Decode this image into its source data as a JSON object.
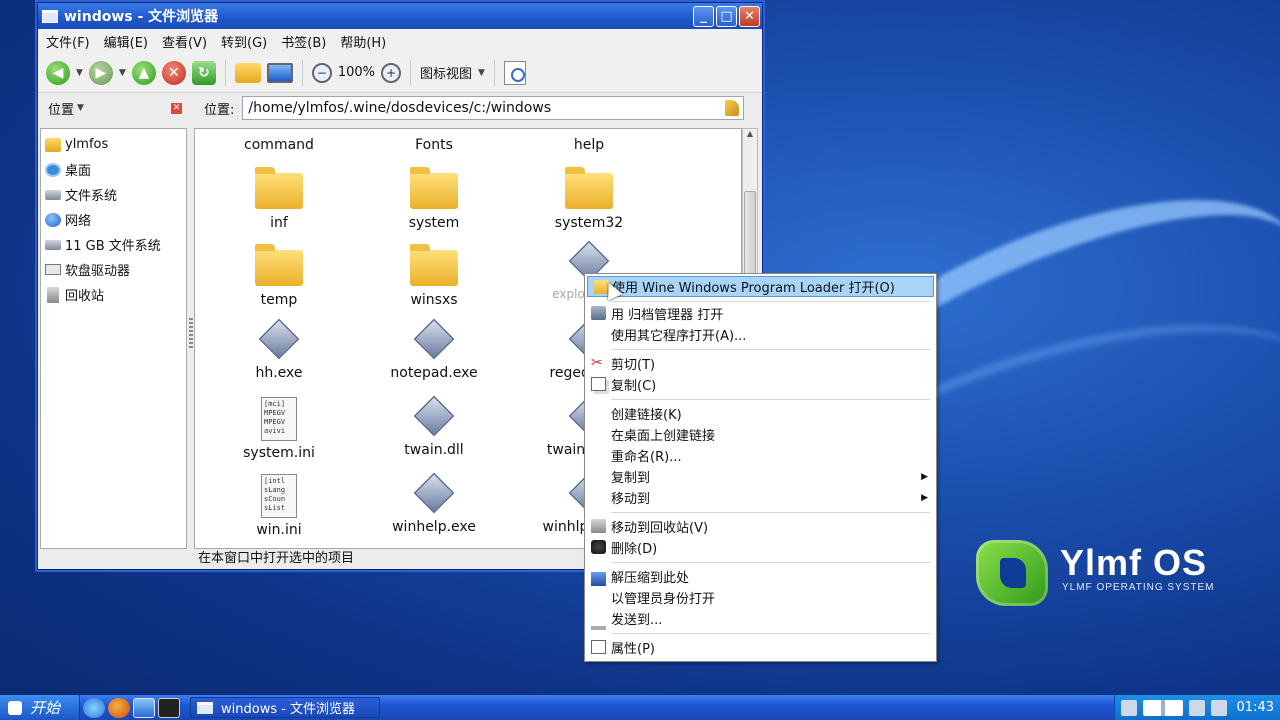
{
  "window": {
    "title": "windows - 文件浏览器",
    "buttons": {
      "minimize": "_",
      "maximize": "□",
      "close": "✕"
    }
  },
  "menubar": [
    "文件(F)",
    "编辑(E)",
    "查看(V)",
    "转到(G)",
    "书签(B)",
    "帮助(H)"
  ],
  "toolbar": {
    "zoom_level": "100%",
    "view_mode": "图标视图"
  },
  "sidebar": {
    "header": "位置",
    "items": [
      "ylmfos",
      "桌面",
      "文件系统",
      "网络",
      "11 GB 文件系统",
      "软盘驱动器",
      "回收站"
    ]
  },
  "location": {
    "label": "位置:",
    "path": "/home/ylmfos/.wine/dosdevices/c:/windows"
  },
  "files": {
    "top_row": [
      "command",
      "Fonts",
      "help"
    ],
    "items": [
      {
        "name": "inf",
        "type": "folder"
      },
      {
        "name": "system",
        "type": "folder"
      },
      {
        "name": "system32",
        "type": "folder"
      },
      {
        "name": "temp",
        "type": "folder"
      },
      {
        "name": "winsxs",
        "type": "folder"
      },
      {
        "name": "explorer.exe",
        "type": "exe"
      },
      {
        "name": "hh.exe",
        "type": "exe"
      },
      {
        "name": "notepad.exe",
        "type": "exe"
      },
      {
        "name": "regedit.exe",
        "type": "exe"
      },
      {
        "name": "system.ini",
        "type": "ini",
        "preview": "[mci]\nMPEGV\nMPEGV\navivi"
      },
      {
        "name": "twain.dll",
        "type": "exe"
      },
      {
        "name": "twain_32.dll",
        "type": "exe"
      },
      {
        "name": "win.ini",
        "type": "ini",
        "preview": "[intl\nsLang\nsCoun\nsList"
      },
      {
        "name": "winhelp.exe",
        "type": "exe"
      },
      {
        "name": "winhlp32.exe",
        "type": "exe"
      }
    ]
  },
  "statusbar": "在本窗口中打开选中的项目",
  "context_menu": {
    "groups": [
      [
        {
          "label": "使用 Wine Windows Program Loader 打开(O)",
          "icon": "wine-icon",
          "active": true
        },
        {
          "label": "用 归档管理器 打开",
          "icon": "archive-icon"
        },
        {
          "label": "使用其它程序打开(A)...",
          "icon": ""
        }
      ],
      [
        {
          "label": "剪切(T)",
          "icon": "scissors-icon"
        },
        {
          "label": "复制(C)",
          "icon": "copy-icon"
        }
      ],
      [
        {
          "label": "创建链接(K)",
          "icon": ""
        },
        {
          "label": "在桌面上创建链接",
          "icon": ""
        },
        {
          "label": "重命名(R)...",
          "icon": ""
        },
        {
          "label": "复制到",
          "icon": "",
          "submenu": true
        },
        {
          "label": "移动到",
          "icon": "",
          "submenu": true
        }
      ],
      [
        {
          "label": "移动到回收站(V)",
          "icon": "trash-icon"
        },
        {
          "label": "删除(D)",
          "icon": "delete-icon"
        }
      ],
      [
        {
          "label": "解压缩到此处",
          "icon": "extract-icon"
        },
        {
          "label": "以管理员身份打开",
          "icon": ""
        },
        {
          "label": "发送到...",
          "icon": "send-icon"
        }
      ],
      [
        {
          "label": "属性(P)",
          "icon": "properties-icon"
        }
      ]
    ]
  },
  "desktop": {
    "logo_text": "Ylmf OS",
    "logo_sub": "YLMF OPERATING SYSTEM"
  },
  "taskbar": {
    "start_label": "开始",
    "task_label": "windows - 文件浏览器",
    "clock": "01:43"
  }
}
